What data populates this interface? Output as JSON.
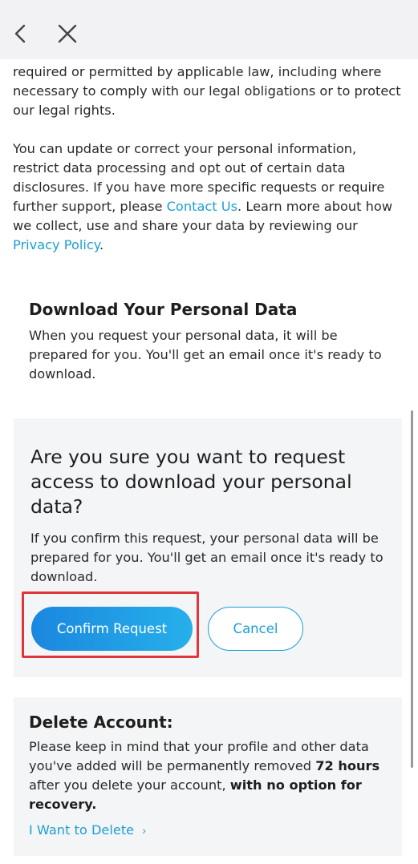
{
  "topbar": {
    "back_icon": "chevron-left-icon",
    "close_icon": "close-icon"
  },
  "intro": {
    "para1": "required or permitted by applicable law, including where necessary to comply with our legal obligations or to protect our legal rights.",
    "para2_part1": "You can update or correct your personal information, restrict data processing and opt out of certain data disclosures. If you have more specific requests or require further support, please ",
    "contact_link": "Contact Us",
    "para2_part2": ". Learn more about how we collect, use and share your data by reviewing our ",
    "privacy_link": "Privacy Policy",
    "para2_part3": "."
  },
  "download": {
    "title": "Download Your Personal Data",
    "description": "When you request your personal data, it will be prepared for you. You'll get an email once it's ready to download."
  },
  "confirm": {
    "question": "Are you sure you want to request access to download your personal data?",
    "description": "If you confirm this request, your personal data will be prepared for you. You'll get an email once it's ready to download.",
    "confirm_label": "Confirm Request",
    "cancel_label": "Cancel"
  },
  "delete": {
    "title": "Delete Account:",
    "desc_part1": "Please keep in mind that your profile and other data you've added will be permanently removed ",
    "desc_bold1": "72 hours",
    "desc_part2": " after you delete your account, ",
    "desc_bold2": "with no option for recovery.",
    "link_label": "I Want to Delete",
    "link_chevron": "›"
  },
  "colors": {
    "link": "#1d9fd1",
    "primary_start": "#1b87df",
    "primary_end": "#26b0ea",
    "highlight": "#e0363a",
    "card_bg": "#f4f5f7",
    "topbar_bg": "#f2f2f4"
  }
}
